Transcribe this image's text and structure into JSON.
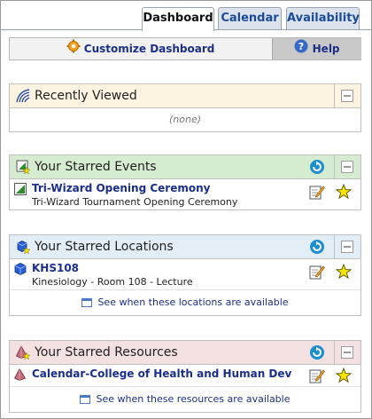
{
  "tabs": [
    {
      "label": "Dashboard",
      "active": true
    },
    {
      "label": "Calendar",
      "active": false
    },
    {
      "label": "Availability",
      "active": false
    }
  ],
  "toolbar": {
    "customize_label": "Customize Dashboard",
    "customize_icon": "gear-icon",
    "help_label": "Help",
    "help_icon": "help-icon"
  },
  "recently_viewed": {
    "title": "Recently Viewed",
    "empty_text": "(none)",
    "header_color": "#fdf3e1"
  },
  "starred_events": {
    "title": "Your Starred Events",
    "header_color": "#d6ecd0",
    "items": [
      {
        "title": "Tri-Wizard Opening Ceremony",
        "subtitle": "Tri-Wizard Tournament Opening Ceremony"
      }
    ]
  },
  "starred_locations": {
    "title": "Your Starred Locations",
    "header_color": "#e2edf6",
    "items": [
      {
        "title": "KHS108",
        "subtitle": "Kinesiology - Room 108 - Lecture"
      }
    ],
    "availability_link": "See when these locations are available"
  },
  "starred_resources": {
    "title": "Your Starred Resources",
    "header_color": "#f3e0e0",
    "items": [
      {
        "title": "Calendar-College of Health and Human Dev"
      }
    ],
    "availability_link": "See when these resources are available"
  },
  "colors": {
    "link": "#1a2e8c",
    "star": "#f5e400",
    "refresh": "#1b8fd1"
  }
}
